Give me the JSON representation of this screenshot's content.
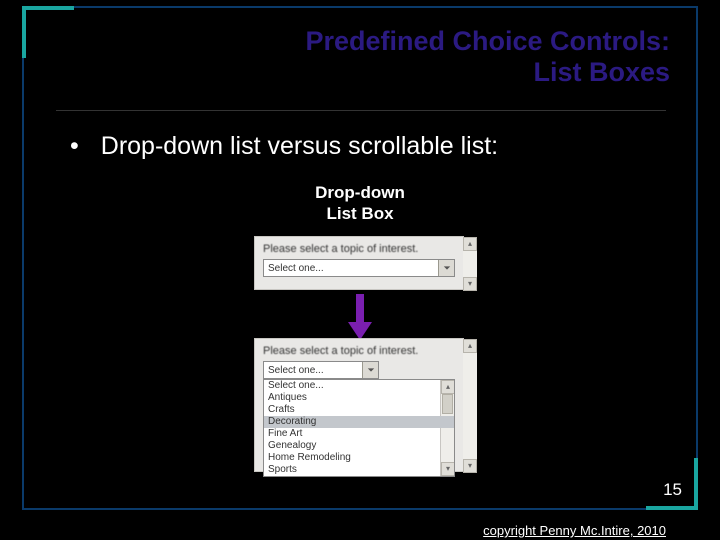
{
  "slide": {
    "title_line1": "Predefined Choice Controls:",
    "title_line2": "List Boxes",
    "bullet": "•",
    "bullet_text": "Drop-down list versus scrollable list:",
    "subhead_line1": "Drop-down",
    "subhead_line2": "List Box",
    "page_number": "15",
    "copyright": "copyright Penny Mc.Intire, 2010"
  },
  "colors": {
    "title": "#2b1a82",
    "accent": "#1aa6a0",
    "arrow": "#7a1fb0"
  },
  "example": {
    "prompt": "Please select a topic of interest.",
    "dropdown_selected": "Select one...",
    "list_options": [
      "Select one...",
      "Antiques",
      "Crafts",
      "Decorating",
      "Fine Art",
      "Genealogy",
      "Home Remodeling",
      "Sports"
    ],
    "list_selected_index": 3
  }
}
